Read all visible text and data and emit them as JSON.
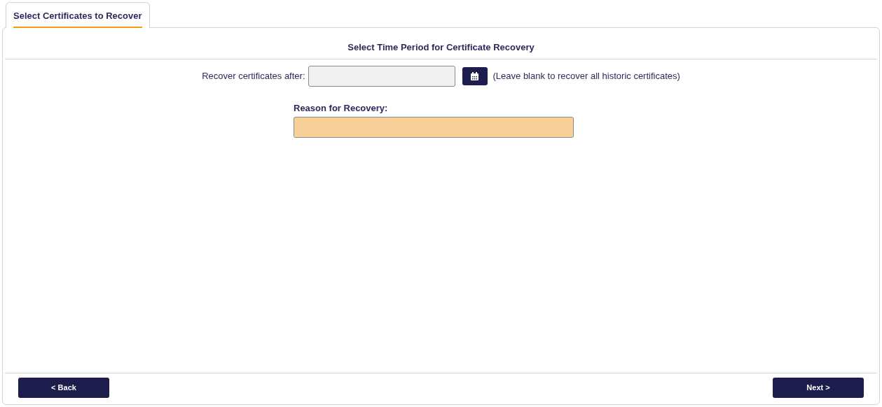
{
  "tabs": [
    {
      "label": "Select Certificates to Recover",
      "selected": true
    }
  ],
  "section_title": "Select Time Period for Certificate Recovery",
  "date_field": {
    "label": "Recover certificates after:",
    "hint": "(Leave blank to recover all historic certificates)"
  },
  "reason_field": {
    "label": "Reason for Recovery:"
  },
  "buttons": {
    "back": "< Back",
    "next": "Next >"
  }
}
